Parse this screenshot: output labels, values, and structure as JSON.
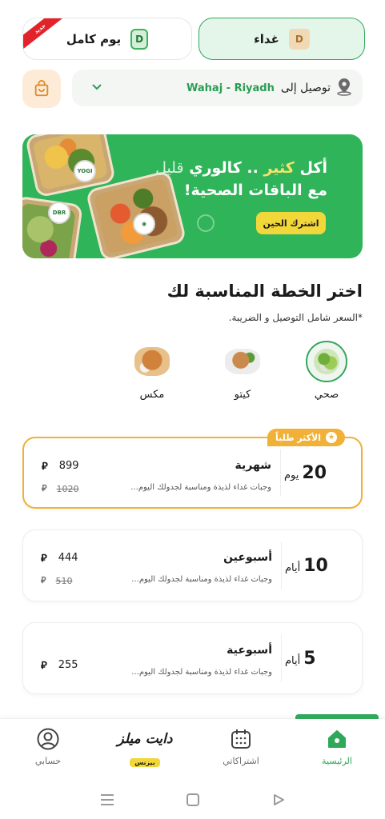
{
  "meal_tabs": {
    "full_day": {
      "label": "يوم كامل",
      "ribbon": "جديد",
      "icon": "day-chip-icon"
    },
    "lunch": {
      "label": "غداء",
      "icon": "lunch-bag-icon"
    }
  },
  "delivery": {
    "prefix": "توصيل إلى",
    "location": "Wahaj - Riyadh"
  },
  "banner": {
    "line1_a": "أكل",
    "line1_b": "كثير",
    "line1_c": ".. كالوري",
    "line1_d": "قليل",
    "line2": "مع الباقات الصحية!",
    "cta": "اشترك الحين",
    "badges": [
      "YOGI",
      "DBR",
      "◉"
    ]
  },
  "plans_section": {
    "title": "اختر الخطة المناسبة لك",
    "note": "*السعر شامل التوصيل و الضريبة."
  },
  "categories": [
    {
      "label": "صحي",
      "selected": true
    },
    {
      "label": "كيتو",
      "selected": false
    },
    {
      "label": "مكس",
      "selected": false
    }
  ],
  "plans": [
    {
      "count": "20",
      "unit": "يوم",
      "name": "شهرية",
      "desc": "وجبات غداء لذيذة ومناسبة لجدولك اليوم...",
      "price": "899",
      "old_price": "1020",
      "badge": "الأكثر طلباً"
    },
    {
      "count": "10",
      "unit": "أيام",
      "name": "أسبوعين",
      "desc": "وجبات غداء لذيذة ومناسبة لجدولك اليوم...",
      "price": "444",
      "old_price": "510"
    },
    {
      "count": "5",
      "unit": "أيام",
      "name": "أسبوعية",
      "desc": "وجبات غداء لذيذة ومناسبة لجدولك اليوم...",
      "price": "255"
    }
  ],
  "currency_symbol": "⃁",
  "currency_fallback": "ر.س",
  "bottom_nav": {
    "home": "الرئيسية",
    "subscriptions": "اشتراكاتي",
    "brand": "دايت ميلز",
    "brand_tag": "بيزنس",
    "account": "حسابي"
  },
  "colors": {
    "primary": "#2fa85a",
    "accent": "#f0b136",
    "banner": "#2fb45a",
    "cta": "#f2d73a"
  }
}
